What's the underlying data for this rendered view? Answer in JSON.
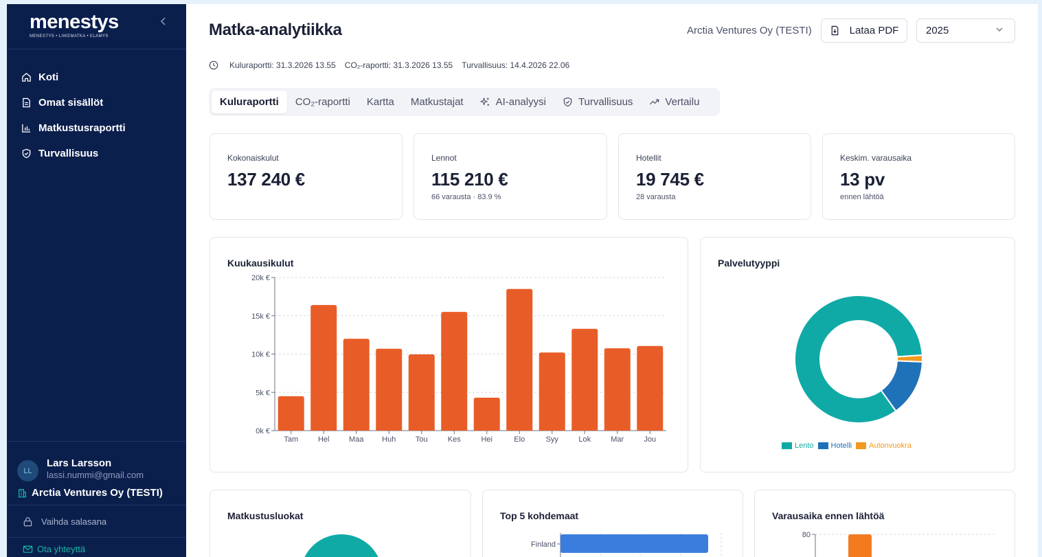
{
  "app": {
    "logo": "menestys",
    "tagline": "MENESTYS • LIIKEMATKA • ELÄMYS"
  },
  "sidebar": {
    "items": [
      {
        "label": "Koti",
        "icon": "home-icon"
      },
      {
        "label": "Omat sisällöt",
        "icon": "document-icon"
      },
      {
        "label": "Matkustusraportti",
        "icon": "bar-chart-icon"
      },
      {
        "label": "Turvallisuus",
        "icon": "shield-icon"
      }
    ],
    "user": {
      "initials": "LL",
      "name": "Lars Larsson",
      "email": "lassi.nummi@gmail.com"
    },
    "org": "Arctia Ventures Oy (TESTI)",
    "change_password": "Vaihda salasana",
    "contact": "Ota yhteyttä"
  },
  "header": {
    "title": "Matka-analytiikka",
    "company": "Arctia Ventures Oy (TESTI)",
    "pdf_label": "Lataa PDF",
    "year": "2025"
  },
  "reports": [
    "Kuluraportti: 31.3.2026 13.55",
    "CO₂-raportti: 31.3.2026 13.55",
    "Turvallisuus: 14.4.2026 22.06"
  ],
  "tabs": [
    {
      "label": "Kuluraportti",
      "active": true
    },
    {
      "label": "CO₂-raportti"
    },
    {
      "label": "Kartta"
    },
    {
      "label": "Matkustajat"
    },
    {
      "label": "AI-analyysi",
      "icon": "sparkle-icon"
    },
    {
      "label": "Turvallisuus",
      "icon": "shield-icon"
    },
    {
      "label": "Vertailu",
      "icon": "trend-icon"
    }
  ],
  "kpis": [
    {
      "label": "Kokonaiskulut",
      "value": "137 240 €",
      "sub": ""
    },
    {
      "label": "Lennot",
      "value": "115 210 €",
      "sub": "66 varausta · 83.9 %"
    },
    {
      "label": "Hotellit",
      "value": "19 745 €",
      "sub": "28 varausta"
    },
    {
      "label": "Keskim. varausaika",
      "value": "13 pv",
      "sub": "ennen lähtöä"
    }
  ],
  "cards": {
    "monthly_title": "Kuukausikulut",
    "service_title": "Palvelutyyppi",
    "classes_title": "Matkustusluokat",
    "top5_title": "Top 5 kohdemaat",
    "booking_title": "Varausaika ennen lähtöä"
  },
  "colors": {
    "sidebar_bg": "#0b1f4d",
    "bar": "#e85d27",
    "flight": "#10aaa6",
    "hotel": "#1f72b8",
    "car": "#f2991f",
    "top5_bar": "#3b7ddd",
    "booking_bar": "#f47a20"
  },
  "chart_data": [
    {
      "type": "bar",
      "title": "Kuukausikulut",
      "categories": [
        "Tam",
        "Hel",
        "Maa",
        "Huh",
        "Tou",
        "Kes",
        "Hei",
        "Elo",
        "Syy",
        "Lok",
        "Mar",
        "Jou"
      ],
      "values": [
        4500,
        16400,
        12000,
        10700,
        9950,
        15500,
        4300,
        18500,
        10200,
        13300,
        10750,
        11050
      ],
      "yticks": [
        "0k €",
        "5k €",
        "10k €",
        "15k €",
        "20k €"
      ],
      "ylim": [
        0,
        20000
      ],
      "grid": true
    },
    {
      "type": "pie",
      "title": "Palvelutyyppi",
      "labels": [
        "Lento",
        "Hotelli",
        "Autonvuokra"
      ],
      "values": [
        115210,
        19745,
        2285
      ],
      "legend": "bottom"
    },
    {
      "type": "bar",
      "title": "Top 5 kohdemaat",
      "categories": [
        "Finland"
      ],
      "orientation": "horizontal"
    },
    {
      "type": "bar",
      "title": "Varausaika ennen lähtöä",
      "yticks": [
        "80"
      ]
    }
  ]
}
